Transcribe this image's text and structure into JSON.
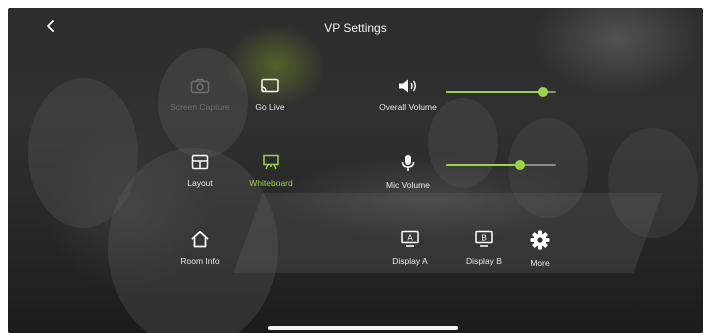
{
  "header": {
    "title": "VP Settings",
    "back_icon": "chevron-left-icon"
  },
  "controls": {
    "screen_capture": {
      "label": "Screen Capture",
      "icon": "camera-icon",
      "state": "disabled"
    },
    "go_live": {
      "label": "Go Live",
      "icon": "cast-icon"
    },
    "layout": {
      "label": "Layout",
      "icon": "layout-icon"
    },
    "whiteboard": {
      "label": "Whiteboard",
      "icon": "whiteboard-icon",
      "state": "active"
    },
    "room_info": {
      "label": "Room Info",
      "icon": "home-icon"
    },
    "display_a": {
      "label": "Display A",
      "icon": "display-a-icon",
      "badge": "A"
    },
    "display_b": {
      "label": "Display B",
      "icon": "display-b-icon",
      "badge": "B"
    },
    "more": {
      "label": "More",
      "icon": "gear-icon"
    }
  },
  "volume": {
    "overall": {
      "label": "Overall Volume",
      "icon": "speaker-icon",
      "level": 0.88
    },
    "mic": {
      "label": "Mic Volume",
      "icon": "microphone-icon",
      "level": 0.67
    }
  },
  "colors": {
    "accent": "#9bd44c",
    "text": "#e9e9e9",
    "disabled": "#6f6f6f",
    "track": "#8c8c8c"
  }
}
